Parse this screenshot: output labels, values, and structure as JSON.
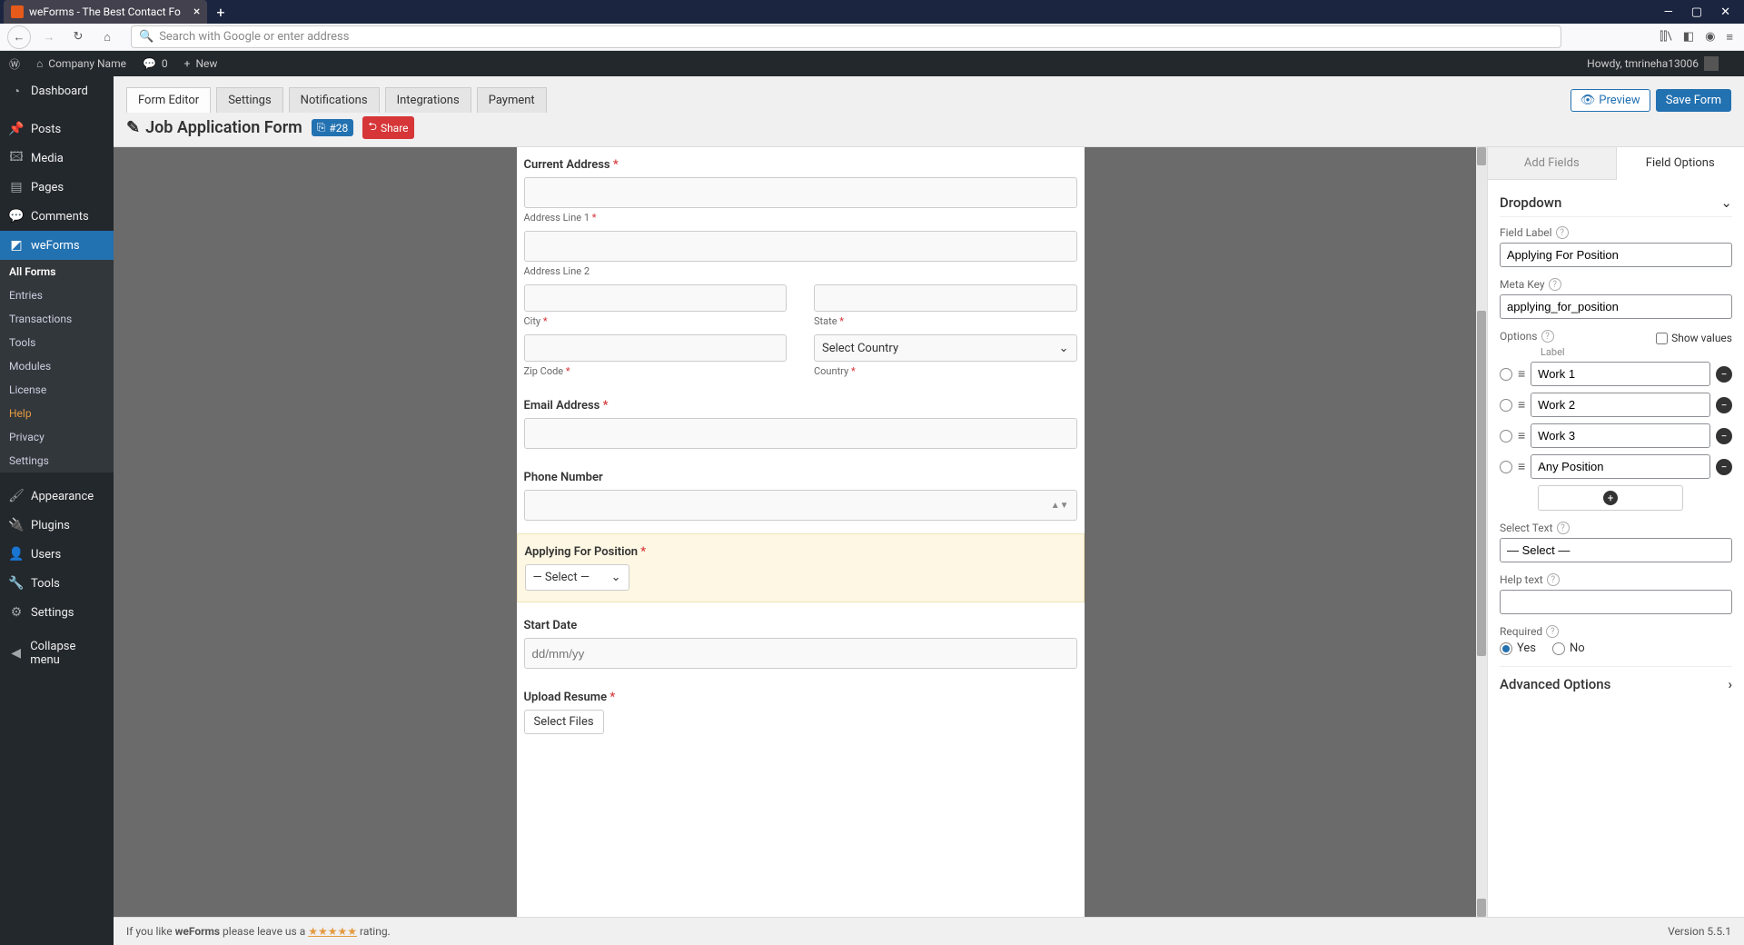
{
  "browser": {
    "tab_title": "weForms - The Best Contact Fo",
    "address_placeholder": "Search with Google or enter address"
  },
  "wp_bar": {
    "site_name": "Company Name",
    "comments": "0",
    "new": "New",
    "greeting": "Howdy, tmrineha13006"
  },
  "wp_menu": {
    "dashboard": "Dashboard",
    "posts": "Posts",
    "media": "Media",
    "pages": "Pages",
    "comments": "Comments",
    "weforms": "weForms",
    "appearance": "Appearance",
    "plugins": "Plugins",
    "users": "Users",
    "tools": "Tools",
    "settings": "Settings",
    "collapse": "Collapse menu"
  },
  "wp_sub": {
    "all_forms": "All Forms",
    "entries": "Entries",
    "transactions": "Transactions",
    "tools": "Tools",
    "modules": "Modules",
    "license": "License",
    "help": "Help",
    "privacy": "Privacy",
    "settings": "Settings"
  },
  "editor_tabs": {
    "form_editor": "Form Editor",
    "settings": "Settings",
    "notifications": "Notifications",
    "integrations": "Integrations",
    "payment": "Payment"
  },
  "actions": {
    "preview": "Preview",
    "save": "Save Form"
  },
  "form": {
    "title": "Job Application Form",
    "count_badge": "#28",
    "share": "Share"
  },
  "fields": {
    "current_address": "Current Address",
    "addr1": "Address Line 1",
    "addr2": "Address Line 2",
    "city": "City",
    "state": "State",
    "zip": "Zip Code",
    "country": "Country",
    "country_select": "Select Country",
    "email": "Email Address",
    "phone": "Phone Number",
    "position": "Applying For Position",
    "position_select": "— Select —",
    "start_date": "Start Date",
    "date_ph": "dd/mm/yy",
    "upload": "Upload Resume",
    "select_files": "Select Files"
  },
  "right_tabs": {
    "add": "Add Fields",
    "options": "Field Options"
  },
  "field_opts": {
    "section": "Dropdown",
    "field_label_l": "Field Label",
    "field_label_v": "Applying For Position",
    "meta_key_l": "Meta Key",
    "meta_key_v": "applying_for_position",
    "options_l": "Options",
    "show_values": "Show values",
    "opt_label_h": "Label",
    "opts": [
      "Work 1",
      "Work 2",
      "Work 3",
      "Any Position"
    ],
    "select_text_l": "Select Text",
    "select_text_v": "— Select —",
    "help_text_l": "Help text",
    "help_text_v": "",
    "required_l": "Required",
    "req_yes": "Yes",
    "req_no": "No",
    "advanced": "Advanced Options"
  },
  "footer": {
    "left_a": "If you like ",
    "left_b": "weForms",
    "left_c": " please leave us a ",
    "stars": "★★★★★",
    "left_d": " rating.",
    "version": "Version 5.5.1"
  }
}
